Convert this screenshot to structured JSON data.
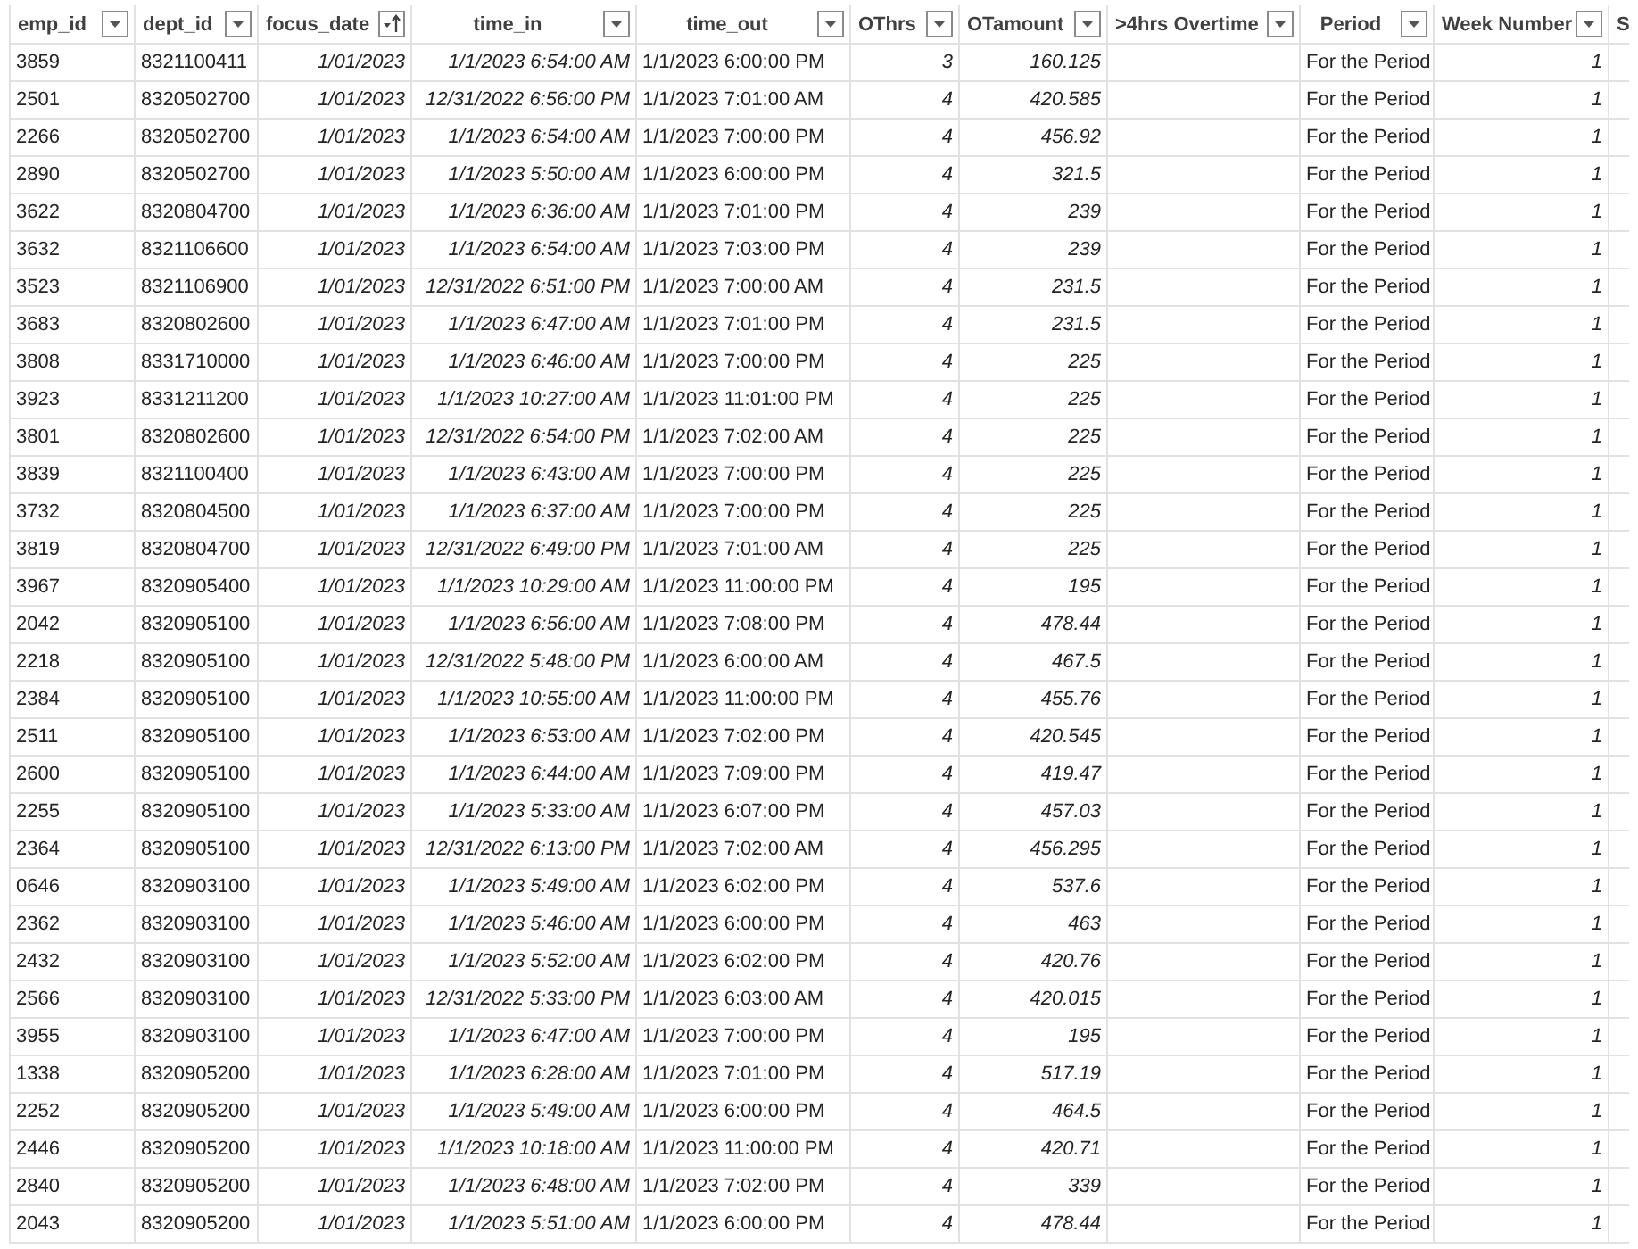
{
  "table": {
    "columns": [
      {
        "label": "emp_id",
        "sorted": false
      },
      {
        "label": "dept_id",
        "sorted": false
      },
      {
        "label": "focus_date",
        "sorted": true
      },
      {
        "label": "time_in",
        "sorted": false
      },
      {
        "label": "time_out",
        "sorted": false
      },
      {
        "label": "OThrs",
        "sorted": false
      },
      {
        "label": "OTamount",
        "sorted": false
      },
      {
        "label": ">4hrs Overtime",
        "sorted": false
      },
      {
        "label": "Period",
        "sorted": false
      },
      {
        "label": "Week Number",
        "sorted": false
      },
      {
        "label": "S"
      }
    ],
    "rows": [
      {
        "emp_id": "3859",
        "dept_id": "8321100411",
        "focus_date": "1/01/2023",
        "time_in": "1/1/2023 6:54:00 AM",
        "time_out": "1/1/2023 6:00:00 PM",
        "OThrs": "3",
        "OTamount": "160.125",
        "period": "For the Period",
        "week_number": "1"
      },
      {
        "emp_id": "2501",
        "dept_id": "8320502700",
        "focus_date": "1/01/2023",
        "time_in": "12/31/2022 6:56:00 PM",
        "time_out": "1/1/2023 7:01:00 AM",
        "OThrs": "4",
        "OTamount": "420.585",
        "period": "For the Period",
        "week_number": "1"
      },
      {
        "emp_id": "2266",
        "dept_id": "8320502700",
        "focus_date": "1/01/2023",
        "time_in": "1/1/2023 6:54:00 AM",
        "time_out": "1/1/2023 7:00:00 PM",
        "OThrs": "4",
        "OTamount": "456.92",
        "period": "For the Period",
        "week_number": "1"
      },
      {
        "emp_id": "2890",
        "dept_id": "8320502700",
        "focus_date": "1/01/2023",
        "time_in": "1/1/2023 5:50:00 AM",
        "time_out": "1/1/2023 6:00:00 PM",
        "OThrs": "4",
        "OTamount": "321.5",
        "period": "For the Period",
        "week_number": "1"
      },
      {
        "emp_id": "3622",
        "dept_id": "8320804700",
        "focus_date": "1/01/2023",
        "time_in": "1/1/2023 6:36:00 AM",
        "time_out": "1/1/2023 7:01:00 PM",
        "OThrs": "4",
        "OTamount": "239",
        "period": "For the Period",
        "week_number": "1"
      },
      {
        "emp_id": "3632",
        "dept_id": "8321106600",
        "focus_date": "1/01/2023",
        "time_in": "1/1/2023 6:54:00 AM",
        "time_out": "1/1/2023 7:03:00 PM",
        "OThrs": "4",
        "OTamount": "239",
        "period": "For the Period",
        "week_number": "1"
      },
      {
        "emp_id": "3523",
        "dept_id": "8321106900",
        "focus_date": "1/01/2023",
        "time_in": "12/31/2022 6:51:00 PM",
        "time_out": "1/1/2023 7:00:00 AM",
        "OThrs": "4",
        "OTamount": "231.5",
        "period": "For the Period",
        "week_number": "1"
      },
      {
        "emp_id": "3683",
        "dept_id": "8320802600",
        "focus_date": "1/01/2023",
        "time_in": "1/1/2023 6:47:00 AM",
        "time_out": "1/1/2023 7:01:00 PM",
        "OThrs": "4",
        "OTamount": "231.5",
        "period": "For the Period",
        "week_number": "1"
      },
      {
        "emp_id": "3808",
        "dept_id": "8331710000",
        "focus_date": "1/01/2023",
        "time_in": "1/1/2023 6:46:00 AM",
        "time_out": "1/1/2023 7:00:00 PM",
        "OThrs": "4",
        "OTamount": "225",
        "period": "For the Period",
        "week_number": "1"
      },
      {
        "emp_id": "3923",
        "dept_id": "8331211200",
        "focus_date": "1/01/2023",
        "time_in": "1/1/2023 10:27:00 AM",
        "time_out": "1/1/2023 11:01:00 PM",
        "OThrs": "4",
        "OTamount": "225",
        "period": "For the Period",
        "week_number": "1"
      },
      {
        "emp_id": "3801",
        "dept_id": "8320802600",
        "focus_date": "1/01/2023",
        "time_in": "12/31/2022 6:54:00 PM",
        "time_out": "1/1/2023 7:02:00 AM",
        "OThrs": "4",
        "OTamount": "225",
        "period": "For the Period",
        "week_number": "1"
      },
      {
        "emp_id": "3839",
        "dept_id": "8321100400",
        "focus_date": "1/01/2023",
        "time_in": "1/1/2023 6:43:00 AM",
        "time_out": "1/1/2023 7:00:00 PM",
        "OThrs": "4",
        "OTamount": "225",
        "period": "For the Period",
        "week_number": "1"
      },
      {
        "emp_id": "3732",
        "dept_id": "8320804500",
        "focus_date": "1/01/2023",
        "time_in": "1/1/2023 6:37:00 AM",
        "time_out": "1/1/2023 7:00:00 PM",
        "OThrs": "4",
        "OTamount": "225",
        "period": "For the Period",
        "week_number": "1"
      },
      {
        "emp_id": "3819",
        "dept_id": "8320804700",
        "focus_date": "1/01/2023",
        "time_in": "12/31/2022 6:49:00 PM",
        "time_out": "1/1/2023 7:01:00 AM",
        "OThrs": "4",
        "OTamount": "225",
        "period": "For the Period",
        "week_number": "1"
      },
      {
        "emp_id": "3967",
        "dept_id": "8320905400",
        "focus_date": "1/01/2023",
        "time_in": "1/1/2023 10:29:00 AM",
        "time_out": "1/1/2023 11:00:00 PM",
        "OThrs": "4",
        "OTamount": "195",
        "period": "For the Period",
        "week_number": "1"
      },
      {
        "emp_id": "2042",
        "dept_id": "8320905100",
        "focus_date": "1/01/2023",
        "time_in": "1/1/2023 6:56:00 AM",
        "time_out": "1/1/2023 7:08:00 PM",
        "OThrs": "4",
        "OTamount": "478.44",
        "period": "For the Period",
        "week_number": "1"
      },
      {
        "emp_id": "2218",
        "dept_id": "8320905100",
        "focus_date": "1/01/2023",
        "time_in": "12/31/2022 5:48:00 PM",
        "time_out": "1/1/2023 6:00:00 AM",
        "OThrs": "4",
        "OTamount": "467.5",
        "period": "For the Period",
        "week_number": "1"
      },
      {
        "emp_id": "2384",
        "dept_id": "8320905100",
        "focus_date": "1/01/2023",
        "time_in": "1/1/2023 10:55:00 AM",
        "time_out": "1/1/2023 11:00:00 PM",
        "OThrs": "4",
        "OTamount": "455.76",
        "period": "For the Period",
        "week_number": "1"
      },
      {
        "emp_id": "2511",
        "dept_id": "8320905100",
        "focus_date": "1/01/2023",
        "time_in": "1/1/2023 6:53:00 AM",
        "time_out": "1/1/2023 7:02:00 PM",
        "OThrs": "4",
        "OTamount": "420.545",
        "period": "For the Period",
        "week_number": "1"
      },
      {
        "emp_id": "2600",
        "dept_id": "8320905100",
        "focus_date": "1/01/2023",
        "time_in": "1/1/2023 6:44:00 AM",
        "time_out": "1/1/2023 7:09:00 PM",
        "OThrs": "4",
        "OTamount": "419.47",
        "period": "For the Period",
        "week_number": "1"
      },
      {
        "emp_id": "2255",
        "dept_id": "8320905100",
        "focus_date": "1/01/2023",
        "time_in": "1/1/2023 5:33:00 AM",
        "time_out": "1/1/2023 6:07:00 PM",
        "OThrs": "4",
        "OTamount": "457.03",
        "period": "For the Period",
        "week_number": "1"
      },
      {
        "emp_id": "2364",
        "dept_id": "8320905100",
        "focus_date": "1/01/2023",
        "time_in": "12/31/2022 6:13:00 PM",
        "time_out": "1/1/2023 7:02:00 AM",
        "OThrs": "4",
        "OTamount": "456.295",
        "period": "For the Period",
        "week_number": "1"
      },
      {
        "emp_id": "0646",
        "dept_id": "8320903100",
        "focus_date": "1/01/2023",
        "time_in": "1/1/2023 5:49:00 AM",
        "time_out": "1/1/2023 6:02:00 PM",
        "OThrs": "4",
        "OTamount": "537.6",
        "period": "For the Period",
        "week_number": "1"
      },
      {
        "emp_id": "2362",
        "dept_id": "8320903100",
        "focus_date": "1/01/2023",
        "time_in": "1/1/2023 5:46:00 AM",
        "time_out": "1/1/2023 6:00:00 PM",
        "OThrs": "4",
        "OTamount": "463",
        "period": "For the Period",
        "week_number": "1"
      },
      {
        "emp_id": "2432",
        "dept_id": "8320903100",
        "focus_date": "1/01/2023",
        "time_in": "1/1/2023 5:52:00 AM",
        "time_out": "1/1/2023 6:02:00 PM",
        "OThrs": "4",
        "OTamount": "420.76",
        "period": "For the Period",
        "week_number": "1"
      },
      {
        "emp_id": "2566",
        "dept_id": "8320903100",
        "focus_date": "1/01/2023",
        "time_in": "12/31/2022 5:33:00 PM",
        "time_out": "1/1/2023 6:03:00 AM",
        "OThrs": "4",
        "OTamount": "420.015",
        "period": "For the Period",
        "week_number": "1"
      },
      {
        "emp_id": "3955",
        "dept_id": "8320903100",
        "focus_date": "1/01/2023",
        "time_in": "1/1/2023 6:47:00 AM",
        "time_out": "1/1/2023 7:00:00 PM",
        "OThrs": "4",
        "OTamount": "195",
        "period": "For the Period",
        "week_number": "1"
      },
      {
        "emp_id": "1338",
        "dept_id": "8320905200",
        "focus_date": "1/01/2023",
        "time_in": "1/1/2023 6:28:00 AM",
        "time_out": "1/1/2023 7:01:00 PM",
        "OThrs": "4",
        "OTamount": "517.19",
        "period": "For the Period",
        "week_number": "1"
      },
      {
        "emp_id": "2252",
        "dept_id": "8320905200",
        "focus_date": "1/01/2023",
        "time_in": "1/1/2023 5:49:00 AM",
        "time_out": "1/1/2023 6:00:00 PM",
        "OThrs": "4",
        "OTamount": "464.5",
        "period": "For the Period",
        "week_number": "1"
      },
      {
        "emp_id": "2446",
        "dept_id": "8320905200",
        "focus_date": "1/01/2023",
        "time_in": "1/1/2023 10:18:00 AM",
        "time_out": "1/1/2023 11:00:00 PM",
        "OThrs": "4",
        "OTamount": "420.71",
        "period": "For the Period",
        "week_number": "1"
      },
      {
        "emp_id": "2840",
        "dept_id": "8320905200",
        "focus_date": "1/01/2023",
        "time_in": "1/1/2023 6:48:00 AM",
        "time_out": "1/1/2023 7:02:00 PM",
        "OThrs": "4",
        "OTamount": "339",
        "period": "For the Period",
        "week_number": "1"
      },
      {
        "emp_id": "2043",
        "dept_id": "8320905200",
        "focus_date": "1/01/2023",
        "time_in": "1/1/2023 5:51:00 AM",
        "time_out": "1/1/2023 6:00:00 PM",
        "OThrs": "4",
        "OTamount": "478.44",
        "period": "For the Period",
        "week_number": "1"
      }
    ]
  }
}
